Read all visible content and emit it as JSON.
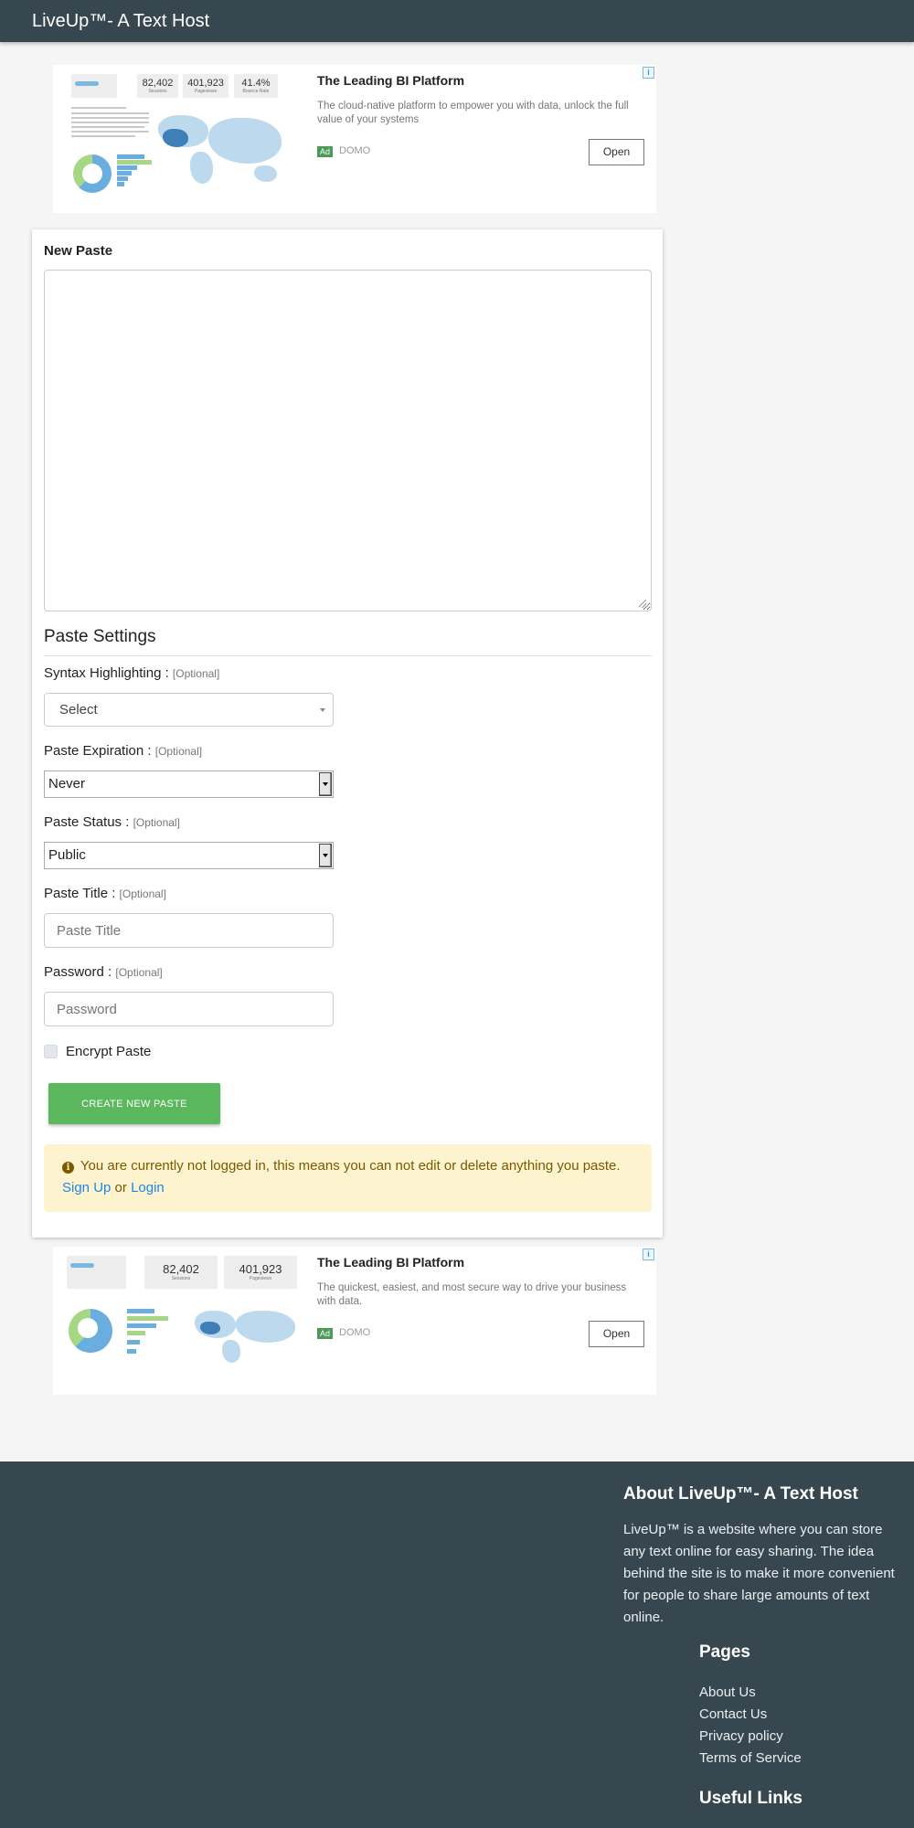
{
  "header": {
    "brand": "LiveUp™- A Text Host"
  },
  "ads": [
    {
      "title": "The Leading BI Platform",
      "description": "The cloud-native platform to empower you with data, unlock the full value of your systems",
      "badge": "Ad",
      "advertiser": "DOMO",
      "open_label": "Open",
      "stats": [
        {
          "value": "82,402",
          "label": "Sessions"
        },
        {
          "value": "401,923",
          "label": "Pageviews"
        },
        {
          "value": "41.4%",
          "label": "Bounce Rate"
        }
      ]
    },
    {
      "title": "The Leading BI Platform",
      "description": "The quickest, easiest, and most secure way to drive your business with data.",
      "badge": "Ad",
      "advertiser": "DOMO",
      "open_label": "Open",
      "stats": [
        {
          "value": "82,402",
          "label": "Sessions"
        },
        {
          "value": "401,923",
          "label": "Pageviews"
        }
      ]
    }
  ],
  "form": {
    "title": "New Paste",
    "paste_value": "",
    "settings_title": "Paste Settings",
    "optional_label": "[Optional]",
    "syntax": {
      "label": "Syntax Highlighting :",
      "value": "Select"
    },
    "expiration": {
      "label": "Paste Expiration :",
      "value": "Never"
    },
    "status": {
      "label": "Paste Status :",
      "value": "Public"
    },
    "title_field": {
      "label": "Paste Title :",
      "placeholder": "Paste Title"
    },
    "password": {
      "label": "Password :",
      "placeholder": "Password"
    },
    "encrypt_label": "Encrypt Paste",
    "submit_label": "Create New Paste"
  },
  "alert": {
    "icon": "info-icon",
    "text": "You are currently not logged in, this means you can not edit or delete anything you paste.",
    "signup": "Sign Up",
    "or": "or",
    "login": "Login"
  },
  "footer": {
    "about_title": "About LiveUp™- A Text Host",
    "about_text": "LiveUp™ is a website where you can store any text online for easy sharing. The idea behind the site is to make it more convenient for people to share large amounts of text online.",
    "pages_title": "Pages",
    "pages": [
      "About Us",
      "Contact Us",
      "Privacy policy",
      "Terms of Service"
    ],
    "useful_title": "Useful Links"
  },
  "colors": {
    "header_bg": "#37474f",
    "button_green": "#5cb85c",
    "alert_bg": "#fdf3ce",
    "link_blue": "#1e88e5"
  }
}
